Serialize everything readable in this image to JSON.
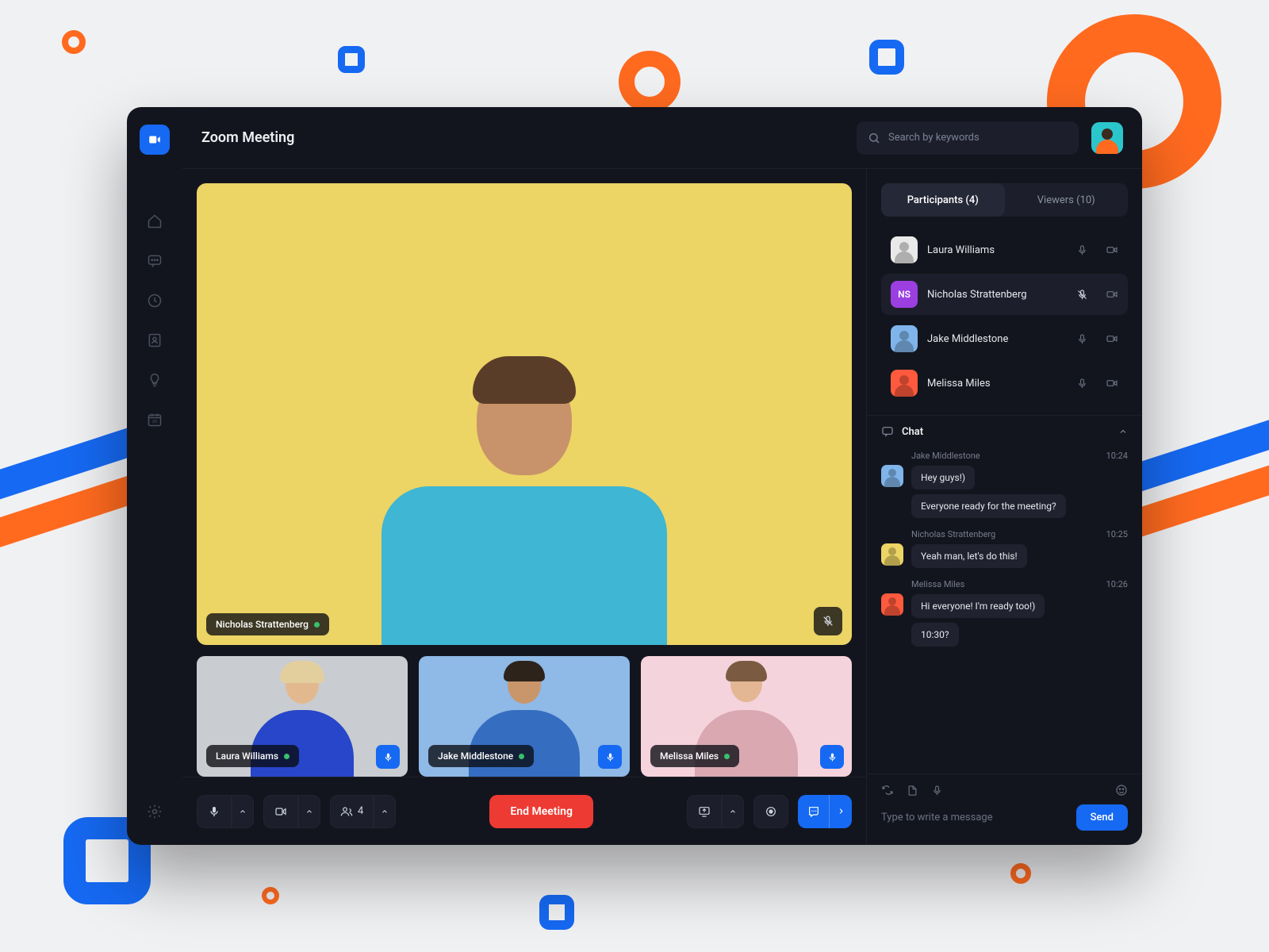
{
  "header": {
    "title": "Zoom Meeting",
    "search_placeholder": "Search by keywords"
  },
  "colors": {
    "accent": "#1669f2",
    "danger": "#ed3a33",
    "bg": "#13151e",
    "panel": "#1c1f2b"
  },
  "main_speaker": {
    "name": "Nicholas Strattenberg",
    "muted": true
  },
  "thumbnails": [
    {
      "name": "Laura Williams"
    },
    {
      "name": "Jake Middlestone"
    },
    {
      "name": "Melissa Miles"
    }
  ],
  "controls": {
    "participants_count": "4",
    "end_label": "End Meeting"
  },
  "tabs": {
    "participants_label": "Participants (4)",
    "viewers_label": "Viewers (10)"
  },
  "participants": [
    {
      "name": "Laura Williams",
      "avatar_bg": "#e9e9e9",
      "initials": "",
      "muted": false
    },
    {
      "name": "Nicholas Strattenberg",
      "avatar_bg": "#9b3fe0",
      "initials": "NS",
      "muted": true,
      "selected": true
    },
    {
      "name": "Jake Middlestone",
      "avatar_bg": "#7fb5ea",
      "initials": "",
      "muted": false
    },
    {
      "name": "Melissa Miles",
      "avatar_bg": "#ff5a3d",
      "initials": "",
      "muted": false
    }
  ],
  "chat": {
    "header": "Chat",
    "messages": [
      {
        "author": "Jake Middlestone",
        "time": "10:24",
        "avatar_bg": "#7fb5ea",
        "bubbles": [
          "Hey guys!)",
          "Everyone ready for the meeting?"
        ]
      },
      {
        "author": "Nicholas Strattenberg",
        "time": "10:25",
        "avatar_bg": "#ecd465",
        "bubbles": [
          "Yeah man, let's do this!"
        ]
      },
      {
        "author": "Melissa Miles",
        "time": "10:26",
        "avatar_bg": "#ff5a3d",
        "bubbles": [
          "Hi everyone! I'm ready too!)",
          "10:30?"
        ]
      }
    ],
    "compose_placeholder": "Type to write a message",
    "send_label": "Send"
  }
}
